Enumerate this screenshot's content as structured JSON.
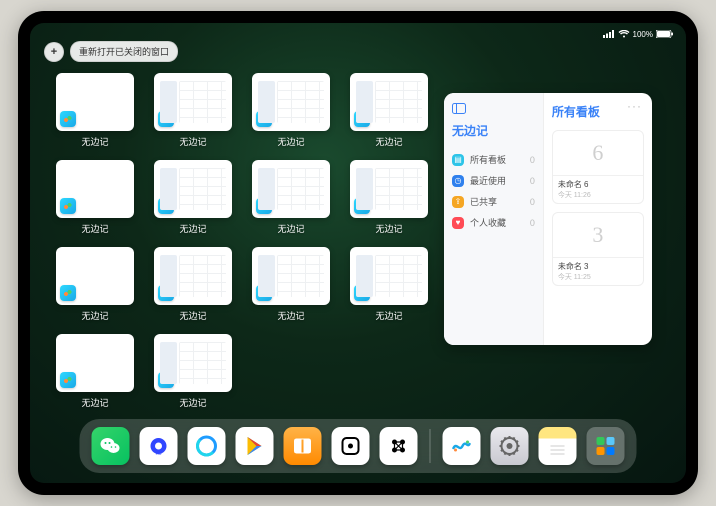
{
  "status": {
    "battery_pct": "100%"
  },
  "topbar": {
    "plus": "+",
    "reopen_label": "重新打开已关闭的窗口"
  },
  "app_label": "无边记",
  "grid_count": 14,
  "panel": {
    "title_left": "无边记",
    "title_right": "所有看板",
    "ellipsis": "···",
    "items": [
      {
        "label": "所有看板",
        "count": "0",
        "color": "#2dc4e8"
      },
      {
        "label": "最近使用",
        "count": "0",
        "color": "#2f80ed"
      },
      {
        "label": "已共享",
        "count": "0",
        "color": "#f5a623"
      },
      {
        "label": "个人收藏",
        "count": "0",
        "color": "#ff4b55"
      }
    ],
    "boards": [
      {
        "glyph": "6",
        "title": "未命名 6",
        "date": "今天 11:26"
      },
      {
        "glyph": "3",
        "title": "未命名 3",
        "date": "今天 11:25"
      }
    ]
  },
  "dock": [
    {
      "name": "wechat",
      "bg": "linear-gradient(135deg,#35d46a,#07c160)"
    },
    {
      "name": "quark",
      "bg": "#fff"
    },
    {
      "name": "qqbrowser",
      "bg": "#fff"
    },
    {
      "name": "play",
      "bg": "#fff"
    },
    {
      "name": "books",
      "bg": "linear-gradient(180deg,#ffb347,#ff8a00)"
    },
    {
      "name": "dice",
      "bg": "#fff"
    },
    {
      "name": "obsidian",
      "bg": "#fff"
    },
    {
      "name": "freeform",
      "bg": "#fff"
    },
    {
      "name": "settings",
      "bg": "linear-gradient(180deg,#e9e9ee,#c9c9d0)"
    },
    {
      "name": "notes",
      "bg": "linear-gradient(180deg,#ffe680 0 30%,#fff 30%)"
    },
    {
      "name": "library",
      "bg": "rgba(255,255,255,.25)"
    }
  ]
}
